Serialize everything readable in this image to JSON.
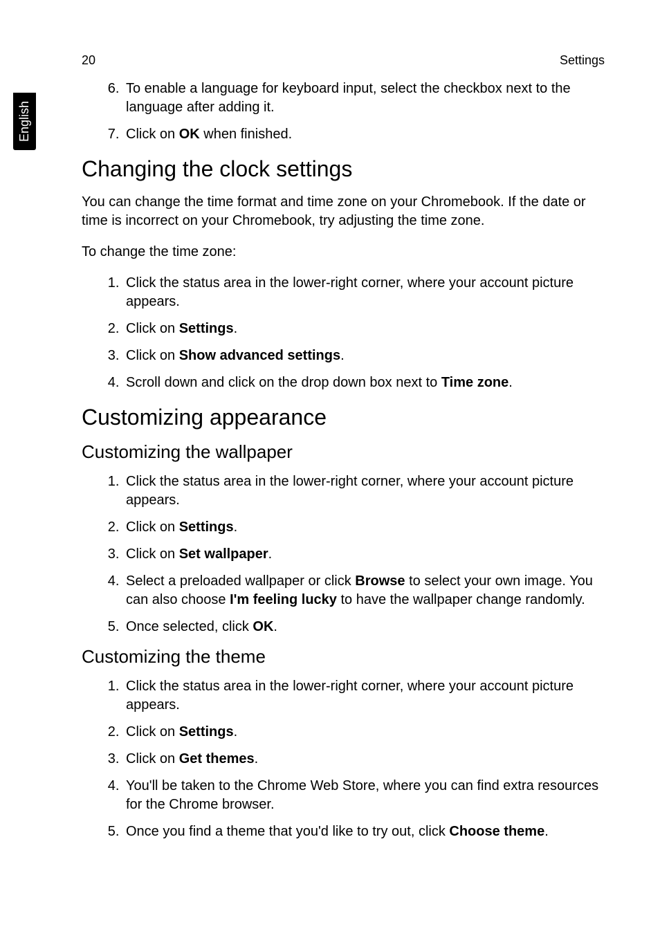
{
  "header": {
    "page_number": "20",
    "section": "Settings"
  },
  "sidetab": "English",
  "list_top": {
    "item6": "To enable a language for keyboard input, select the checkbox next to the language after adding it.",
    "item7_pre": "Click on ",
    "item7_bold": "OK",
    "item7_post": " when finished."
  },
  "h1a": "Changing the clock settings",
  "para1": "You can change the time format and time zone on your Chromebook. If the date or time is incorrect on your Chromebook, try adjusting the time zone.",
  "para2": "To change the time zone:",
  "list_clock": {
    "l1": "Click the status area in the lower-right corner, where your account picture appears.",
    "l2_pre": "Click on ",
    "l2_bold": "Settings",
    "l2_post": ".",
    "l3_pre": "Click on ",
    "l3_bold": "Show advanced settings",
    "l3_post": ".",
    "l4_pre": "Scroll down and click on the drop down box next to ",
    "l4_bold": "Time zone",
    "l4_post": "."
  },
  "h1b": "Customizing appearance",
  "h2a": "Customizing the wallpaper",
  "list_wall": {
    "l1": "Click the status area in the lower-right corner, where your account picture appears.",
    "l2_pre": "Click on ",
    "l2_bold": "Settings",
    "l2_post": ".",
    "l3_pre": "Click on ",
    "l3_bold": "Set wallpaper",
    "l3_post": ".",
    "l4_pre": "Select a preloaded wallpaper or click ",
    "l4_bold1": "Browse",
    "l4_mid": " to select your own image. You can also choose ",
    "l4_bold2": "I'm feeling lucky",
    "l4_post": " to have the wallpaper change randomly.",
    "l5_pre": "Once selected, click ",
    "l5_bold": "OK",
    "l5_post": "."
  },
  "h2b": "Customizing the theme",
  "list_theme": {
    "l1": "Click the status area in the lower-right corner, where your account picture appears.",
    "l2_pre": "Click on ",
    "l2_bold": "Settings",
    "l2_post": ".",
    "l3_pre": "Click on ",
    "l3_bold": "Get themes",
    "l3_post": ".",
    "l4": "You'll be taken to the Chrome Web Store, where you can find extra resources for the Chrome browser.",
    "l5_pre": "Once you find a theme that you'd like to try out, click ",
    "l5_bold": "Choose theme",
    "l5_post": "."
  }
}
